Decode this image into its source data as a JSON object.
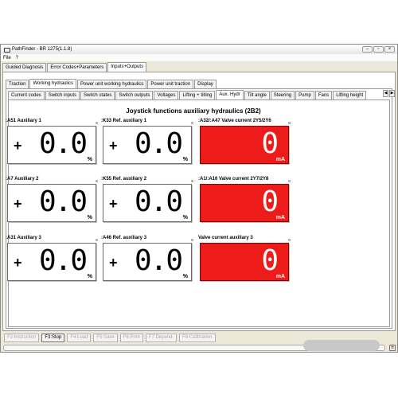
{
  "window": {
    "title": "PathFinder - BR 1275(1.1.8)"
  },
  "menu": [
    "File",
    "?"
  ],
  "main_tabs": [
    "Guided Diagnosis",
    "Error Codes+Parameters",
    "Inputs+Outputs"
  ],
  "sub_tabs": [
    "Traction",
    "Working hydraulics",
    "Power unit working hydraulics",
    "Power unit traction",
    "Display"
  ],
  "detail_tabs": [
    "Current codes",
    "Switch inputs",
    "Switch states",
    "Switch outputs",
    "Voltages",
    "Lifting + tilting",
    "Aux. Hydr",
    "Tilt angle",
    "Steering",
    "Pump",
    "Fans",
    "Lifting height"
  ],
  "content_title": "Joystick functions auxiliary hydraulics (2B2)",
  "tiles": [
    {
      "label": ":A51 Auxiliary 1",
      "sign": "+",
      "value": "0.0",
      "unit": "%",
      "red": false
    },
    {
      "label": ":K33 Ref. auxiliary 1",
      "sign": "+",
      "value": "0.0",
      "unit": "%",
      "red": false
    },
    {
      "label": ":A32/:A47 Valve current 2Y5/2Y6",
      "sign": "",
      "value": "0",
      "unit": "mA",
      "red": true
    },
    {
      "label": ":A7 Auxiliary 2",
      "sign": "+",
      "value": "0.0",
      "unit": "%",
      "red": false
    },
    {
      "label": ":K55 Ref. auxiliary 2",
      "sign": "+",
      "value": "0.0",
      "unit": "%",
      "red": false
    },
    {
      "label": ":A1/:A16 Valve current 2Y7/2Y8",
      "sign": "",
      "value": "0",
      "unit": "mA",
      "red": true
    },
    {
      "label": ":A31 Auxiliary 3",
      "sign": "+",
      "value": "0.0",
      "unit": "%",
      "red": false
    },
    {
      "label": ":A46 Ref. auxiliary 3",
      "sign": "+",
      "value": "0.0",
      "unit": "%",
      "red": false
    },
    {
      "label": "Valve current auxiliary 3",
      "sign": "",
      "value": "0",
      "unit": "mA",
      "red": true
    }
  ],
  "function_buttons": [
    {
      "label": "F2:Instruction",
      "enabled": false
    },
    {
      "label": "F3:Stop",
      "enabled": true
    },
    {
      "label": "F4:Load",
      "enabled": false
    },
    {
      "label": "F5:Save",
      "enabled": false
    },
    {
      "label": "F6:Print",
      "enabled": false
    },
    {
      "label": "F7:Depend.",
      "enabled": false
    },
    {
      "label": "F8:Calibration",
      "enabled": false
    }
  ],
  "colors": {
    "alarm_red": "#ee1b1b",
    "window_bg": "#ece9d8"
  }
}
